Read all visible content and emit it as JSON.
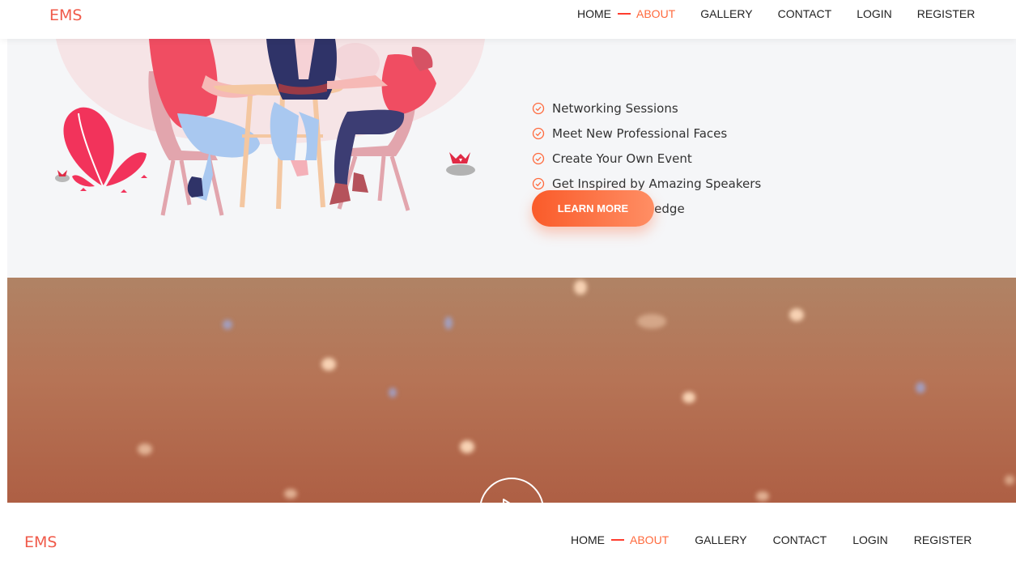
{
  "header": {
    "logo": "EMS",
    "nav": [
      {
        "label": "HOME"
      },
      {
        "label": "ABOUT",
        "active": true
      },
      {
        "label": "GALLERY"
      },
      {
        "label": "CONTACT"
      },
      {
        "label": "LOGIN"
      },
      {
        "label": "REGISTER"
      }
    ]
  },
  "about": {
    "features": [
      "Networking Sessions",
      "Meet New Professional Faces",
      "Create Your Own Event",
      "Get Inspired by Amazing Speakers",
      "Gain More Knowledge"
    ],
    "cta_label": "LEARN MORE"
  },
  "icons": {
    "feature_check": "check-circle-icon",
    "play": "play-icon"
  },
  "colors": {
    "brand": "#f05a4a",
    "accent": "#ff6a3d",
    "button_gradient_start": "#fa5b2a",
    "button_gradient_end": "#ff8e64",
    "section_bg": "#f5f6f8",
    "video_bg": "#b67456"
  }
}
